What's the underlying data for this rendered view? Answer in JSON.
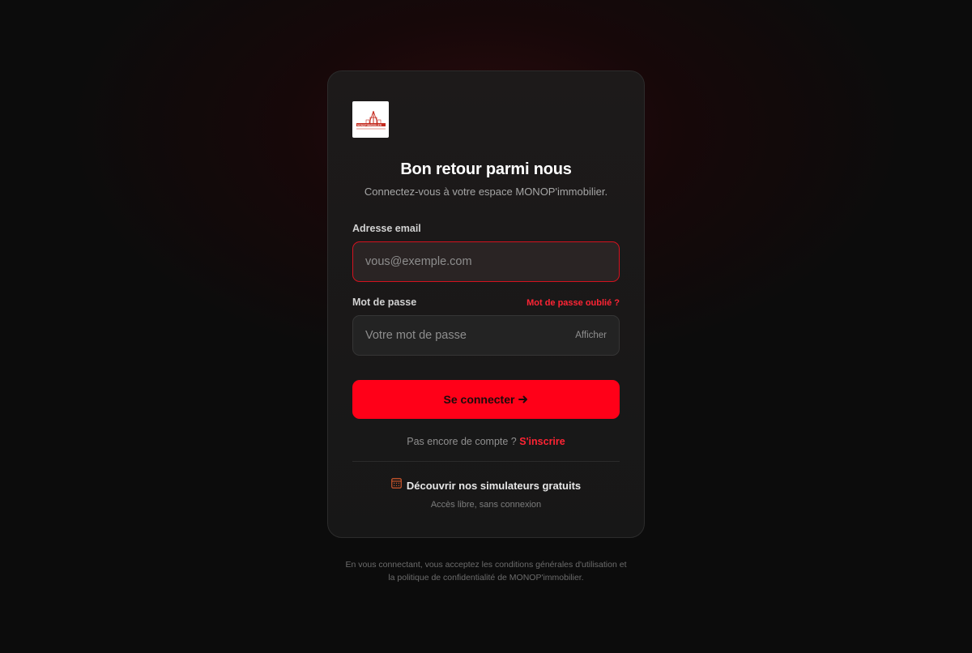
{
  "brand": {
    "logo_text": "MONOP'IMMOBILIER",
    "accent_color": "#ff0018"
  },
  "header": {
    "title": "Bon retour parmi nous",
    "subtitle": "Connectez-vous à votre espace MONOP'immobilier."
  },
  "form": {
    "email": {
      "label": "Adresse email",
      "value": "",
      "placeholder": "vous@exemple.com"
    },
    "password": {
      "label": "Mot de passe",
      "value": "",
      "placeholder": "Votre mot de passe",
      "show_label": "Afficher",
      "forgot_label": "Mot de passe oublié ?"
    },
    "submit_label": "Se connecter",
    "submit_icon": "arrow-right-icon"
  },
  "signup": {
    "prompt": "Pas encore de compte ?",
    "link_label": "S'inscrire"
  },
  "simulators": {
    "icon": "calculator-icon",
    "label": "Découvrir nos simulateurs gratuits",
    "sublabel": "Accès libre, sans connexion"
  },
  "legal": {
    "line1": "En vous connectant, vous acceptez les conditions générales d'utilisation et",
    "line2": "la politique de confidentialité de MONOP'immobilier."
  }
}
